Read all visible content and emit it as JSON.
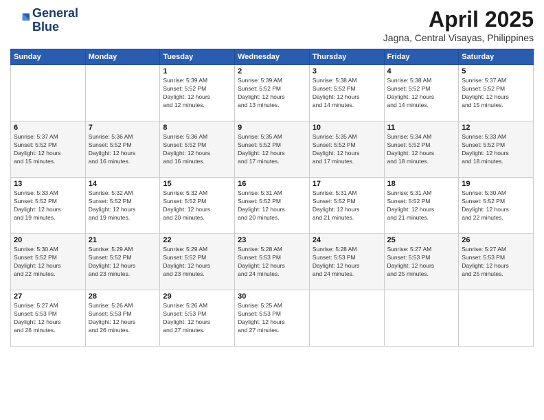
{
  "logo": {
    "line1": "General",
    "line2": "Blue"
  },
  "title": "April 2025",
  "location": "Jagna, Central Visayas, Philippines",
  "days_of_week": [
    "Sunday",
    "Monday",
    "Tuesday",
    "Wednesday",
    "Thursday",
    "Friday",
    "Saturday"
  ],
  "weeks": [
    [
      {
        "day": "",
        "info": ""
      },
      {
        "day": "",
        "info": ""
      },
      {
        "day": "1",
        "info": "Sunrise: 5:39 AM\nSunset: 5:52 PM\nDaylight: 12 hours\nand 12 minutes."
      },
      {
        "day": "2",
        "info": "Sunrise: 5:39 AM\nSunset: 5:52 PM\nDaylight: 12 hours\nand 13 minutes."
      },
      {
        "day": "3",
        "info": "Sunrise: 5:38 AM\nSunset: 5:52 PM\nDaylight: 12 hours\nand 14 minutes."
      },
      {
        "day": "4",
        "info": "Sunrise: 5:38 AM\nSunset: 5:52 PM\nDaylight: 12 hours\nand 14 minutes."
      },
      {
        "day": "5",
        "info": "Sunrise: 5:37 AM\nSunset: 5:52 PM\nDaylight: 12 hours\nand 15 minutes."
      }
    ],
    [
      {
        "day": "6",
        "info": "Sunrise: 5:37 AM\nSunset: 5:52 PM\nDaylight: 12 hours\nand 15 minutes."
      },
      {
        "day": "7",
        "info": "Sunrise: 5:36 AM\nSunset: 5:52 PM\nDaylight: 12 hours\nand 16 minutes."
      },
      {
        "day": "8",
        "info": "Sunrise: 5:36 AM\nSunset: 5:52 PM\nDaylight: 12 hours\nand 16 minutes."
      },
      {
        "day": "9",
        "info": "Sunrise: 5:35 AM\nSunset: 5:52 PM\nDaylight: 12 hours\nand 17 minutes."
      },
      {
        "day": "10",
        "info": "Sunrise: 5:35 AM\nSunset: 5:52 PM\nDaylight: 12 hours\nand 17 minutes."
      },
      {
        "day": "11",
        "info": "Sunrise: 5:34 AM\nSunset: 5:52 PM\nDaylight: 12 hours\nand 18 minutes."
      },
      {
        "day": "12",
        "info": "Sunrise: 5:33 AM\nSunset: 5:52 PM\nDaylight: 12 hours\nand 18 minutes."
      }
    ],
    [
      {
        "day": "13",
        "info": "Sunrise: 5:33 AM\nSunset: 5:52 PM\nDaylight: 12 hours\nand 19 minutes."
      },
      {
        "day": "14",
        "info": "Sunrise: 5:32 AM\nSunset: 5:52 PM\nDaylight: 12 hours\nand 19 minutes."
      },
      {
        "day": "15",
        "info": "Sunrise: 5:32 AM\nSunset: 5:52 PM\nDaylight: 12 hours\nand 20 minutes."
      },
      {
        "day": "16",
        "info": "Sunrise: 5:31 AM\nSunset: 5:52 PM\nDaylight: 12 hours\nand 20 minutes."
      },
      {
        "day": "17",
        "info": "Sunrise: 5:31 AM\nSunset: 5:52 PM\nDaylight: 12 hours\nand 21 minutes."
      },
      {
        "day": "18",
        "info": "Sunrise: 5:31 AM\nSunset: 5:52 PM\nDaylight: 12 hours\nand 21 minutes."
      },
      {
        "day": "19",
        "info": "Sunrise: 5:30 AM\nSunset: 5:52 PM\nDaylight: 12 hours\nand 22 minutes."
      }
    ],
    [
      {
        "day": "20",
        "info": "Sunrise: 5:30 AM\nSunset: 5:52 PM\nDaylight: 12 hours\nand 22 minutes."
      },
      {
        "day": "21",
        "info": "Sunrise: 5:29 AM\nSunset: 5:52 PM\nDaylight: 12 hours\nand 23 minutes."
      },
      {
        "day": "22",
        "info": "Sunrise: 5:29 AM\nSunset: 5:52 PM\nDaylight: 12 hours\nand 23 minutes."
      },
      {
        "day": "23",
        "info": "Sunrise: 5:28 AM\nSunset: 5:53 PM\nDaylight: 12 hours\nand 24 minutes."
      },
      {
        "day": "24",
        "info": "Sunrise: 5:28 AM\nSunset: 5:53 PM\nDaylight: 12 hours\nand 24 minutes."
      },
      {
        "day": "25",
        "info": "Sunrise: 5:27 AM\nSunset: 5:53 PM\nDaylight: 12 hours\nand 25 minutes."
      },
      {
        "day": "26",
        "info": "Sunrise: 5:27 AM\nSunset: 5:53 PM\nDaylight: 12 hours\nand 25 minutes."
      }
    ],
    [
      {
        "day": "27",
        "info": "Sunrise: 5:27 AM\nSunset: 5:53 PM\nDaylight: 12 hours\nand 26 minutes."
      },
      {
        "day": "28",
        "info": "Sunrise: 5:26 AM\nSunset: 5:53 PM\nDaylight: 12 hours\nand 26 minutes."
      },
      {
        "day": "29",
        "info": "Sunrise: 5:26 AM\nSunset: 5:53 PM\nDaylight: 12 hours\nand 27 minutes."
      },
      {
        "day": "30",
        "info": "Sunrise: 5:25 AM\nSunset: 5:53 PM\nDaylight: 12 hours\nand 27 minutes."
      },
      {
        "day": "",
        "info": ""
      },
      {
        "day": "",
        "info": ""
      },
      {
        "day": "",
        "info": ""
      }
    ]
  ]
}
